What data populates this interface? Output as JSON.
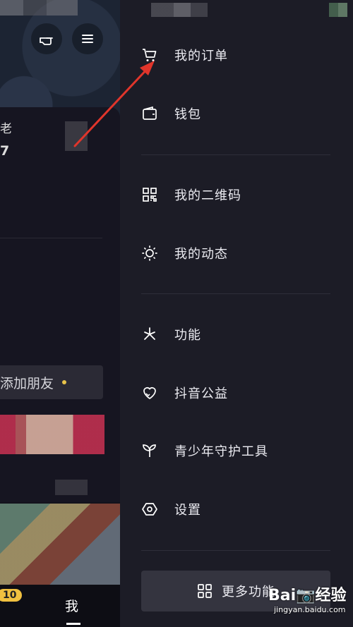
{
  "background": {
    "stat_label": "老",
    "stat_value": "7",
    "add_friend": "添加朋友",
    "tab_badge": "10",
    "tab_me": "我"
  },
  "drawer": {
    "group1": [
      {
        "label": "我的订单",
        "icon": "cart-icon"
      },
      {
        "label": "钱包",
        "icon": "wallet-icon"
      }
    ],
    "group2": [
      {
        "label": "我的二维码",
        "icon": "qr-code-icon"
      },
      {
        "label": "我的动态",
        "icon": "activity-icon"
      }
    ],
    "group3": [
      {
        "label": "功能",
        "icon": "features-icon"
      },
      {
        "label": "抖音公益",
        "icon": "charity-heart-icon"
      },
      {
        "label": "青少年守护工具",
        "icon": "sprout-icon"
      },
      {
        "label": "设置",
        "icon": "settings-icon"
      }
    ],
    "more_button": "更多功能"
  },
  "watermark": {
    "logo": "Bai📷经验",
    "site": "jingyan.baidu.com"
  },
  "colors": {
    "drawer_bg": "#1c1c26",
    "annotation_arrow": "#e0352b",
    "badge": "#f0c040"
  }
}
